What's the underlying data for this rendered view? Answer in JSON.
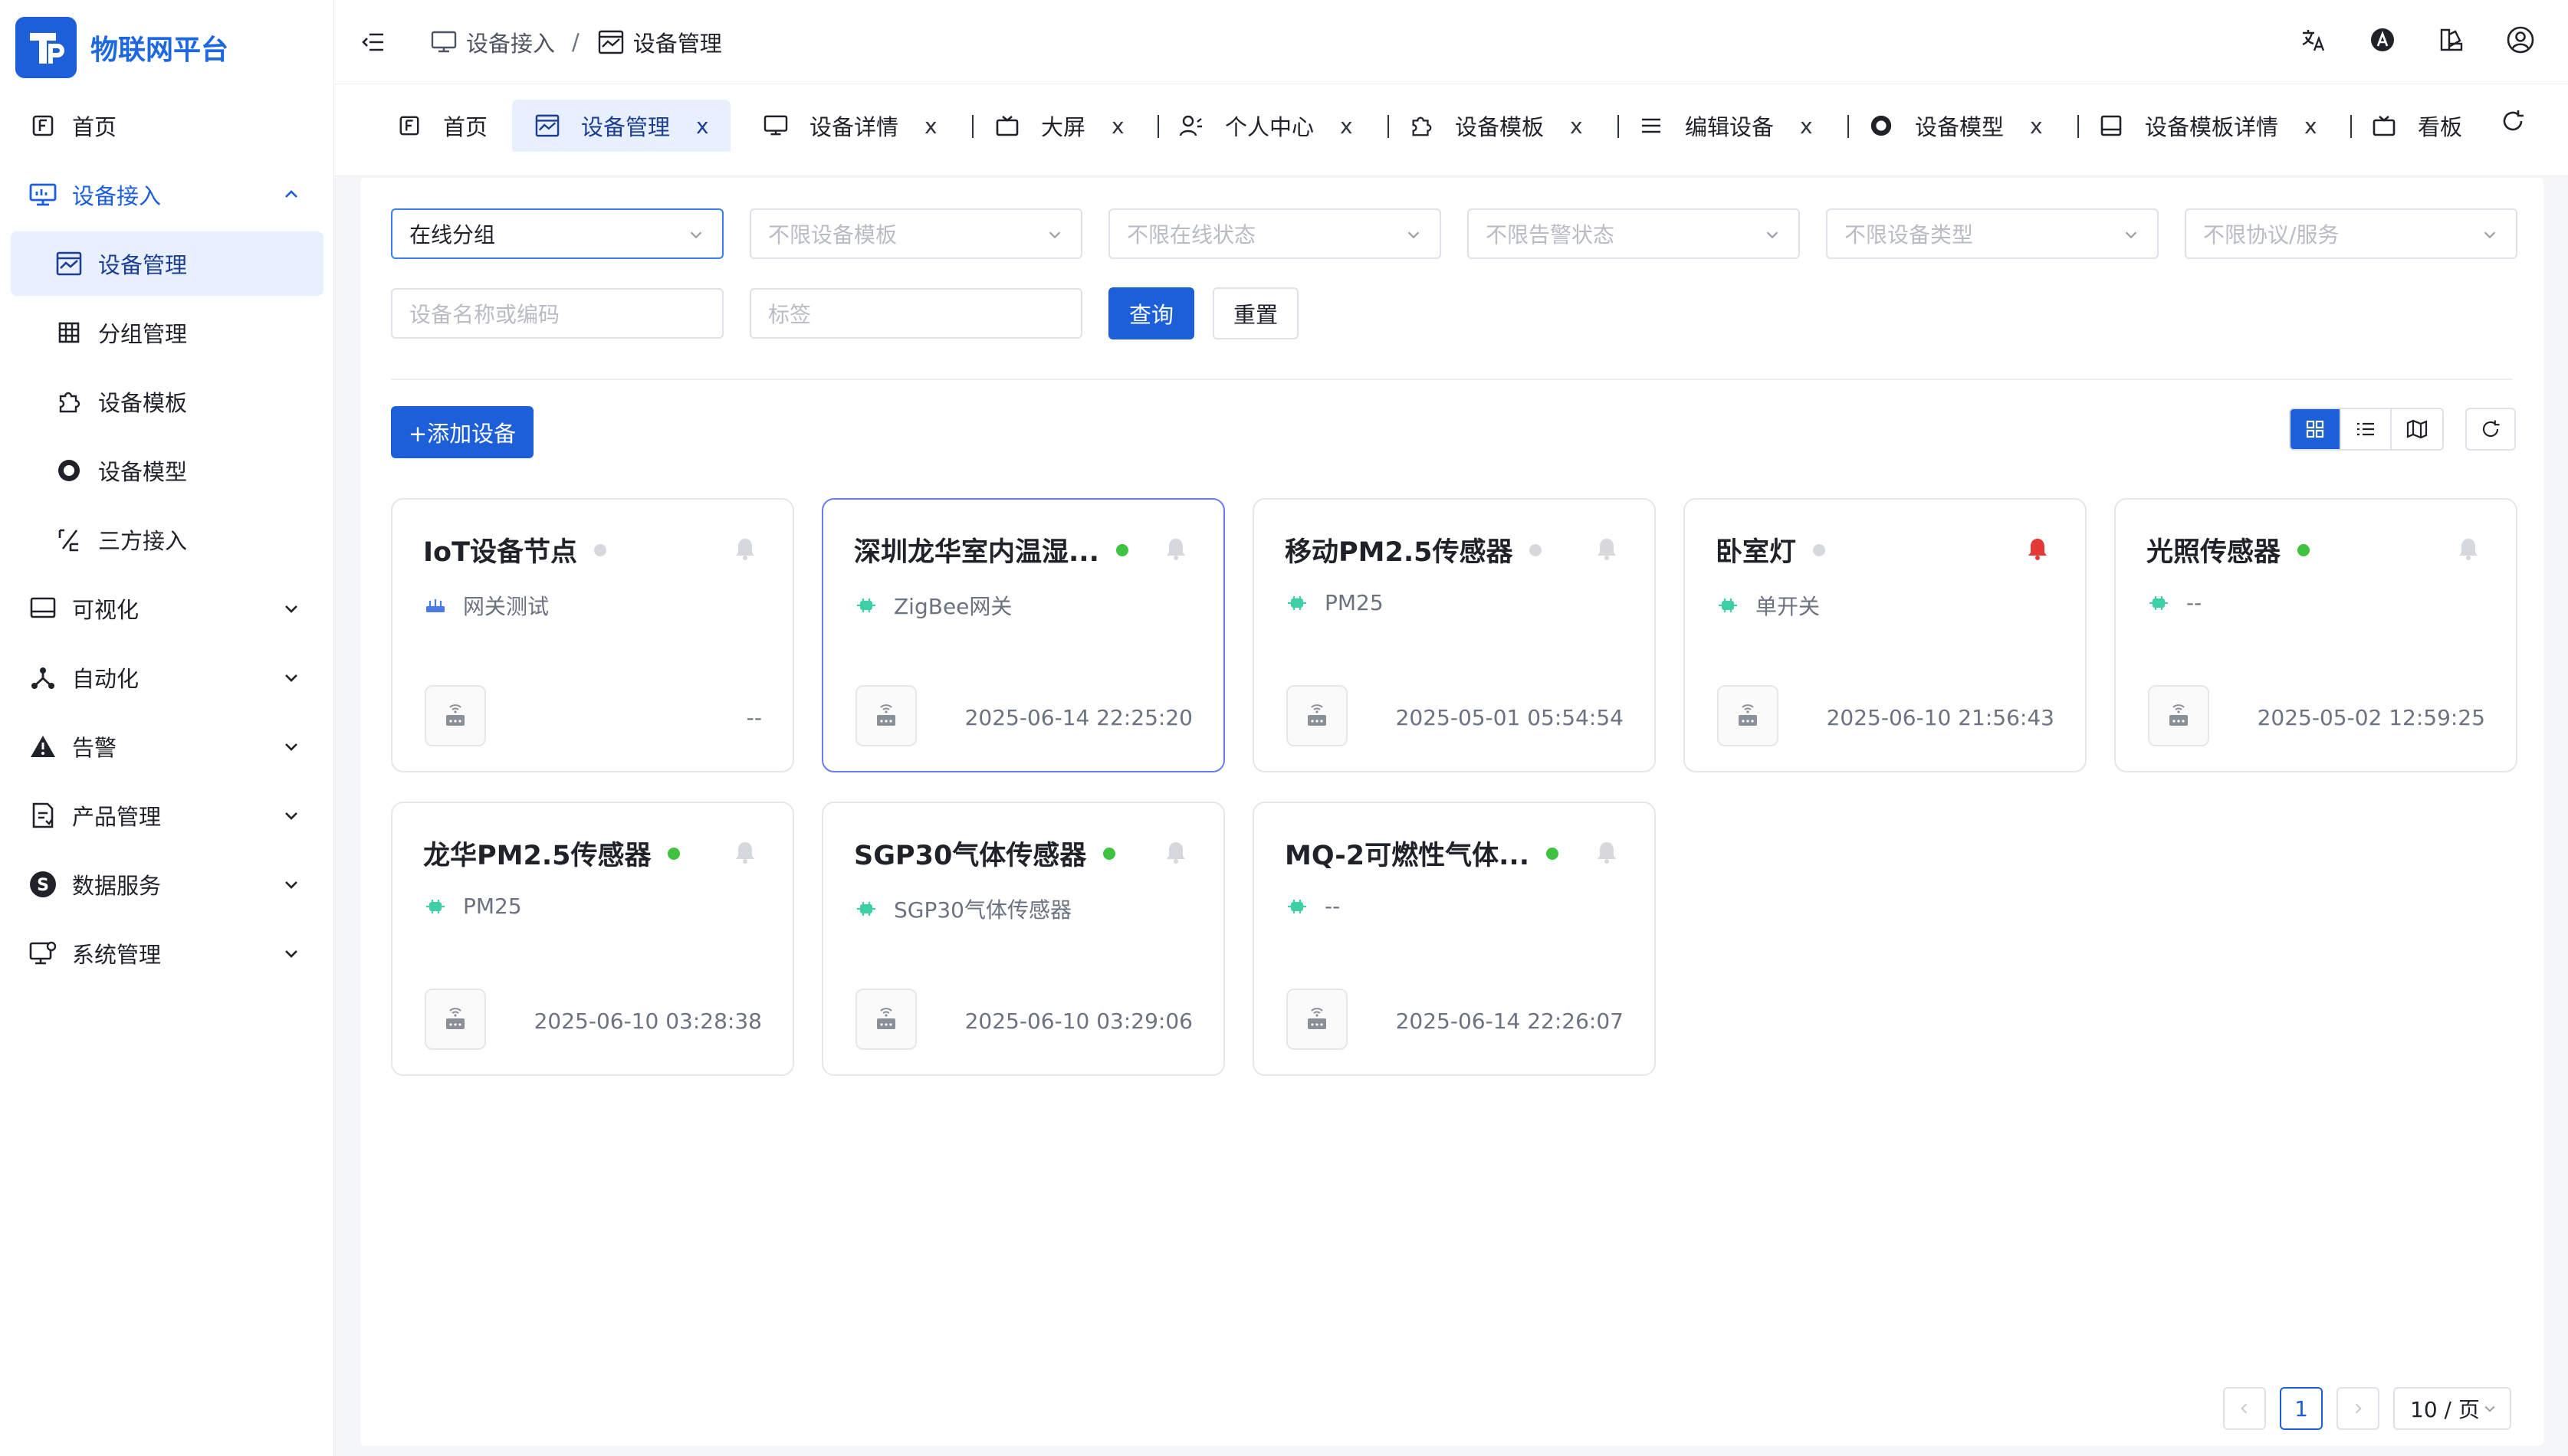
{
  "brand": {
    "title": "物联网平台"
  },
  "sidebar": {
    "items": [
      {
        "label": "首页",
        "icon": "home-icon"
      },
      {
        "label": "设备接入",
        "icon": "monitor-icon",
        "expanded": true
      },
      {
        "label": "设备管理",
        "icon": "device-chart-icon",
        "active": true
      },
      {
        "label": "分组管理",
        "icon": "grid-icon"
      },
      {
        "label": "设备模板",
        "icon": "puzzle-icon"
      },
      {
        "label": "设备模型",
        "icon": "circle-icon"
      },
      {
        "label": "三方接入",
        "icon": "percent-icon"
      },
      {
        "label": "可视化",
        "icon": "screen-icon"
      },
      {
        "label": "自动化",
        "icon": "share-icon"
      },
      {
        "label": "告警",
        "icon": "warning-icon"
      },
      {
        "label": "产品管理",
        "icon": "doc-icon"
      },
      {
        "label": "数据服务",
        "icon": "s-icon"
      },
      {
        "label": "系统管理",
        "icon": "system-icon"
      }
    ]
  },
  "header": {
    "breadcrumb": [
      "设备接入",
      "设备管理"
    ]
  },
  "tabs": [
    {
      "label": "首页",
      "closable": false
    },
    {
      "label": "设备管理",
      "closable": true,
      "active": true
    },
    {
      "label": "设备详情",
      "closable": true
    },
    {
      "label": "大屏",
      "closable": true
    },
    {
      "label": "个人中心",
      "closable": true
    },
    {
      "label": "设备模板",
      "closable": true
    },
    {
      "label": "编辑设备",
      "closable": true
    },
    {
      "label": "设备模型",
      "closable": true
    },
    {
      "label": "设备模板详情",
      "closable": true
    },
    {
      "label": "看板",
      "closable": false
    }
  ],
  "filters": {
    "group": "在线分组",
    "template": "不限设备模板",
    "online": "不限在线状态",
    "alarm": "不限告警状态",
    "type": "不限设备类型",
    "protocol": "不限协议/服务",
    "name_placeholder": "设备名称或编码",
    "tag_placeholder": "标签",
    "query": "查询",
    "reset": "重置"
  },
  "toolbar": {
    "add": "+添加设备"
  },
  "devices": [
    {
      "name": "IoT设备节点",
      "status": "offline",
      "alarm": false,
      "sub": "网关测试",
      "sub_icon": "router-icon",
      "time": "--"
    },
    {
      "name": "深圳龙华室内温湿...",
      "status": "online",
      "alarm": false,
      "sub": "ZigBee网关",
      "sub_icon": "chip-icon",
      "time": "2025-06-14 22:25:20"
    },
    {
      "name": "移动PM2.5传感器",
      "status": "offline",
      "alarm": false,
      "sub": "PM25",
      "sub_icon": "chip-icon",
      "time": "2025-05-01 05:54:54"
    },
    {
      "name": "卧室灯",
      "status": "offline",
      "alarm": true,
      "sub": "单开关",
      "sub_icon": "chip-icon",
      "time": "2025-06-10 21:56:43"
    },
    {
      "name": "光照传感器",
      "status": "online",
      "alarm": false,
      "sub": "--",
      "sub_icon": "chip-icon",
      "time": "2025-05-02 12:59:25"
    },
    {
      "name": "龙华PM2.5传感器",
      "status": "online",
      "alarm": false,
      "sub": "PM25",
      "sub_icon": "chip-icon",
      "time": "2025-06-10 03:28:38"
    },
    {
      "name": "SGP30气体传感器",
      "status": "online",
      "alarm": false,
      "sub": "SGP30气体传感器",
      "sub_icon": "chip-icon",
      "time": "2025-06-10 03:29:06"
    },
    {
      "name": "MQ-2可燃性气体...",
      "status": "online",
      "alarm": false,
      "sub": "--",
      "sub_icon": "chip-icon",
      "time": "2025-06-14 22:26:07"
    }
  ],
  "pagination": {
    "current": "1",
    "page_size": "10 / 页"
  },
  "colors": {
    "primary": "#1d5fd8",
    "online": "#3fc23f",
    "offline": "#d5d8dd",
    "alarm": "#e53935",
    "chip": "#3ecfa6"
  }
}
